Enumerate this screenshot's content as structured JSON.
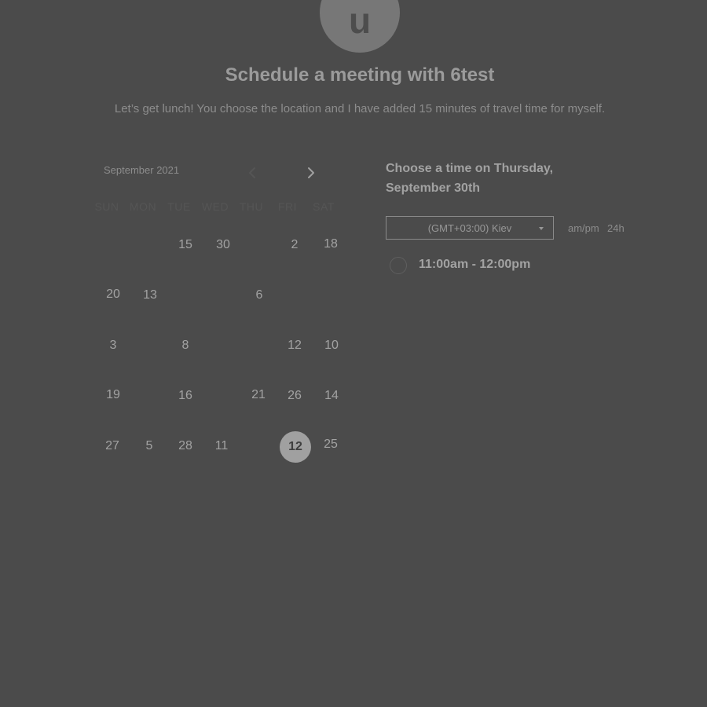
{
  "avatar": {
    "initial": "u"
  },
  "header": {
    "title": "Schedule a meeting with 6test",
    "subtitle": "Let’s get lunch! You choose the location and I have added 15 minutes of travel time for myself."
  },
  "calendar": {
    "month_label": "September 2021",
    "prev_icon": "chevron-left-icon",
    "next_icon": "chevron-right-icon",
    "weekdays": [
      "SUN",
      "MON",
      "TUE",
      "WED",
      "THU",
      "FRI",
      "SAT"
    ],
    "days": [
      {
        "label": "15"
      },
      {
        "label": "30"
      },
      {
        "label": "2"
      },
      {
        "label": "18"
      },
      {
        "label": "20"
      },
      {
        "label": "13"
      },
      {
        "label": "6"
      },
      {
        "label": "3"
      },
      {
        "label": "8"
      },
      {
        "label": "12"
      },
      {
        "label": "10"
      },
      {
        "label": "19"
      },
      {
        "label": "16"
      },
      {
        "label": "21"
      },
      {
        "label": "26"
      },
      {
        "label": "14"
      },
      {
        "label": "27"
      },
      {
        "label": "5"
      },
      {
        "label": "28"
      },
      {
        "label": "11"
      },
      {
        "label": "12",
        "selected": true
      },
      {
        "label": "25"
      }
    ]
  },
  "panel": {
    "title": "Choose a time on Thursday, September 30th",
    "timezone": {
      "value": "(GMT+03:00) Kiev",
      "caret_icon": "caret-down-icon"
    },
    "format_ampm": "am/pm",
    "format_24h": "24h",
    "slots": [
      {
        "label": "11:00am - 12:00pm"
      }
    ]
  },
  "colors": {
    "background": "#4b4b4b",
    "text": "#a2a2a2",
    "selected_day_bg": "#a0a0a0"
  }
}
